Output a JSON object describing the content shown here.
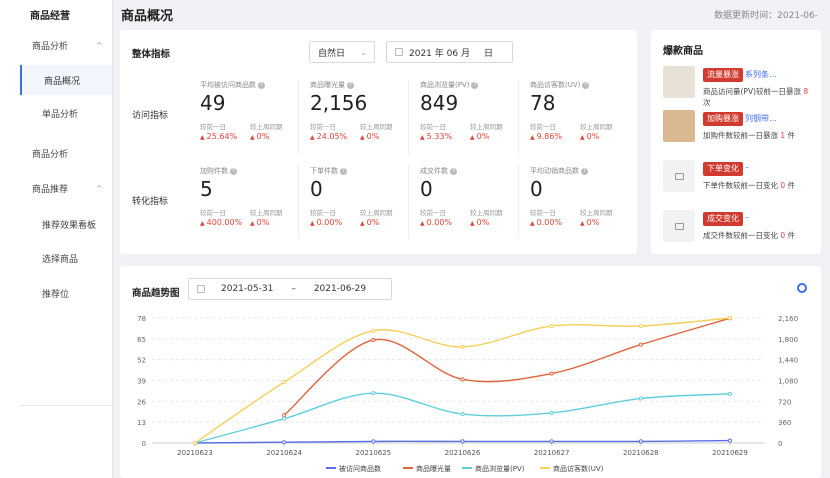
{
  "sidebar": {
    "title": "商品经营",
    "items": [
      {
        "label": "商品分析",
        "type": "group",
        "chev": "^"
      },
      {
        "label": "商品概况",
        "type": "sub",
        "active": true
      },
      {
        "label": "单品分析",
        "type": "sub"
      },
      {
        "label": "商品分析",
        "type": "group"
      },
      {
        "label": "商品推荐",
        "type": "group",
        "chev": "^"
      },
      {
        "label": "推荐效果看板",
        "type": "sub"
      },
      {
        "label": "选择商品",
        "type": "sub"
      },
      {
        "label": "推荐位",
        "type": "sub"
      }
    ]
  },
  "header": {
    "title": "商品概况",
    "update_time": "数据更新时间：2021-06-"
  },
  "overview": {
    "title": "整体指标",
    "period_select": "自然日",
    "date": "2021 年 06 月 ",
    "date_suffix": "日",
    "rows": [
      {
        "label": "访问指标",
        "metrics": [
          {
            "name": "平均被访问商品数",
            "value": "49",
            "c1_label": "较前一日",
            "c1": "25.64%",
            "c2_label": "较上周同期",
            "c2": "0%"
          },
          {
            "name": "商品曝光量",
            "value": "2,156",
            "c1_label": "较前一日",
            "c1": "24.05%",
            "c2_label": "较上周同期",
            "c2": "0%"
          },
          {
            "name": "商品浏览量(PV)",
            "value": "849",
            "c1_label": "较前一日",
            "c1": "5.33%",
            "c2_label": "较上周同期",
            "c2": "0%"
          },
          {
            "name": "商品访客数(UV)",
            "value": "78",
            "c1_label": "较前一日",
            "c1": "9.86%",
            "c2_label": "较上周同期",
            "c2": "0%"
          }
        ]
      },
      {
        "label": "转化指标",
        "metrics": [
          {
            "name": "加购件数",
            "value": "5",
            "c1_label": "较前一日",
            "c1": "400.00%",
            "c2_label": "较上周同期",
            "c2": "0%"
          },
          {
            "name": "下单件数",
            "value": "0",
            "c1_label": "较前一日",
            "c1": "0.00%",
            "c2_label": "较上周同期",
            "c2": "0%"
          },
          {
            "name": "成交件数",
            "value": "0",
            "c1_label": "较前一日",
            "c1": "0.00%",
            "c2_label": "较上周同期",
            "c2": "0%"
          },
          {
            "name": "平均动销商品数",
            "value": "0",
            "c1_label": "较前一日",
            "c1": "0.00%",
            "c2_label": "较上周同期",
            "c2": "0%"
          }
        ]
      }
    ]
  },
  "hot": {
    "title": "爆款商品",
    "items": [
      {
        "tag": "流量暴涨",
        "name": "系列条…",
        "desc_pre": "商品访问量(PV)较前一日暴涨 ",
        "num": "8",
        "desc_post": " 次",
        "thumb": "#e8e2d6"
      },
      {
        "tag": "加购暴涨",
        "name": "列钢带…",
        "desc_pre": "加购件数较前一日暴涨 ",
        "num": "1",
        "desc_post": " 件",
        "thumb": "#d9b892"
      },
      {
        "tag": "下单变化",
        "name": "–",
        "desc_pre": "下单件数较前一日变化 ",
        "num": "0",
        "desc_post": " 件",
        "thumb": ""
      },
      {
        "tag": "成交变化",
        "name": "–",
        "desc_pre": "成交件数较前一日变化 ",
        "num": "0",
        "desc_post": " 件",
        "thumb": ""
      }
    ]
  },
  "trend": {
    "title": "商品趋势图",
    "start_date": "2021-05-31",
    "range_sep": "–",
    "end_date": "2021-06-29"
  },
  "chart_data": {
    "type": "line",
    "x": [
      "20210623",
      "20210624",
      "20210625",
      "20210626",
      "20210627",
      "20210628",
      "20210629"
    ],
    "left_ticks": [
      "0",
      "13",
      "26",
      "39",
      "52",
      "65",
      "78"
    ],
    "right_ticks": [
      "0",
      "360",
      "720",
      "1,080",
      "1,440",
      "1,800",
      "2,160"
    ],
    "ylim_left": [
      0,
      78
    ],
    "ylim_right": [
      0,
      2160
    ],
    "series": [
      {
        "name": "被访问商品数",
        "axis": "left",
        "color": "#5b6ee8",
        "values": [
          0,
          0.5,
          1,
          1,
          1,
          1,
          1.5
        ]
      },
      {
        "name": "商品曝光量",
        "axis": "right",
        "color": "#e0623a",
        "values": [
          null,
          480,
          1780,
          1100,
          1200,
          1700,
          2156
        ]
      },
      {
        "name": "商品浏览量(PV)",
        "axis": "right",
        "color": "#5fcfdc",
        "values": [
          0,
          420,
          860,
          500,
          520,
          770,
          849
        ]
      },
      {
        "name": "商品访客数(UV)",
        "axis": "left",
        "color": "#f5cf5a",
        "values": [
          0,
          38,
          70,
          60,
          73,
          73,
          78
        ]
      }
    ],
    "grid": true,
    "legend": "bottom"
  }
}
